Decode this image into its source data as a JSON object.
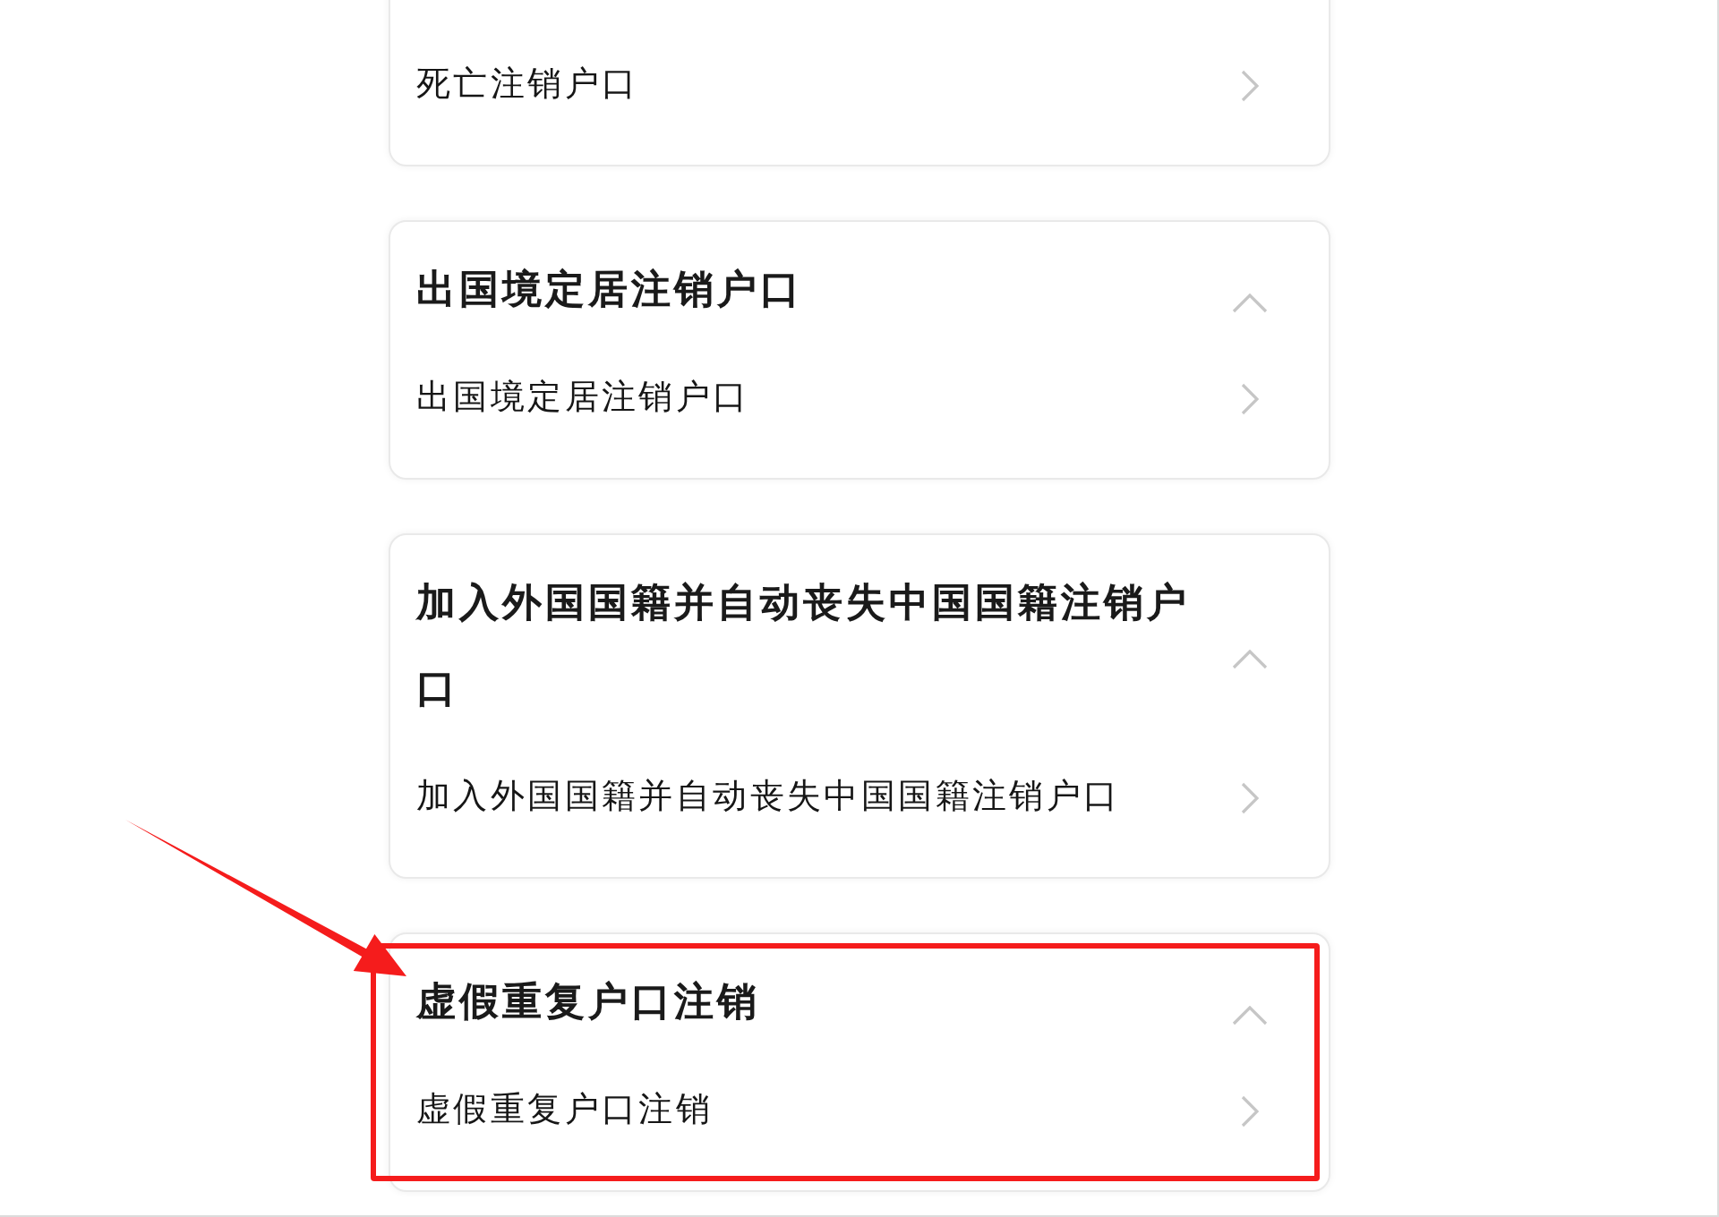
{
  "cards": [
    {
      "items": [
        {
          "label": "死亡注销户口"
        }
      ]
    },
    {
      "title": "出国境定居注销户口",
      "expanded": true,
      "items": [
        {
          "label": "出国境定居注销户口"
        }
      ]
    },
    {
      "title": "加入外国国籍并自动丧失中国国籍注销户口",
      "expanded": true,
      "items": [
        {
          "label": "加入外国国籍并自动丧失中国国籍注销户口"
        }
      ]
    },
    {
      "title": "虚假重复户口注销",
      "expanded": true,
      "items": [
        {
          "label": "虚假重复户口注销"
        }
      ]
    }
  ]
}
